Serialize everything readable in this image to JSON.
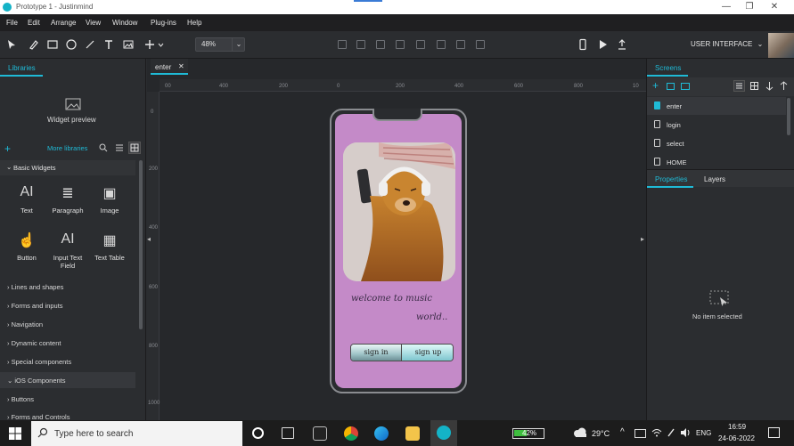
{
  "window": {
    "title": "Prototype 1 - Justinmind",
    "min": "—",
    "max": "❐",
    "close": "✕"
  },
  "menu": [
    "File",
    "Edit",
    "Arrange",
    "View",
    "Window",
    "Plug-ins",
    "Help"
  ],
  "toolbar": {
    "zoom": "48%",
    "zoom_caret": "⌄",
    "mode_label": "USER INTERFACE",
    "mode_caret": "⌄"
  },
  "left_panel": {
    "tab": "Libraries",
    "preview_label": "Widget preview",
    "more_libraries": "More libraries",
    "basic_widgets": "Basic Widgets",
    "widgets": [
      "Text",
      "Paragraph",
      "Image",
      "Button",
      "Input Text Field",
      "Text Table"
    ],
    "widget_glyphs": [
      "AI",
      "≣",
      "▣",
      "☝",
      "AI",
      "▦"
    ],
    "categories": [
      "Lines and shapes",
      "Forms and inputs",
      "Navigation",
      "Dynamic content",
      "Special components",
      "iOS Components",
      "Buttons",
      "Forms and Controls"
    ],
    "caret_open": "⌄",
    "caret_closed": "›"
  },
  "canvas": {
    "tab_label": "enter",
    "tab_close": "✕",
    "ruler_h": [
      "00",
      "400",
      "200",
      "0",
      "200",
      "400",
      "600",
      "800",
      "10"
    ],
    "ruler_v": [
      "0",
      "200",
      "400",
      "600",
      "800",
      "1000"
    ],
    "phone": {
      "welcome_line1": "welcome to music",
      "welcome_line2": "world..",
      "signin": "sign in",
      "signup": "sign up"
    }
  },
  "right_panel": {
    "tab": "Screens",
    "screens": [
      "enter",
      "login",
      "select",
      "HOME"
    ],
    "properties_tab": "Properties",
    "layers_tab": "Layers",
    "no_selection": "No item selected"
  },
  "taskbar": {
    "search_placeholder": "Type here to search",
    "battery": "42%",
    "weather": "29°C",
    "lang": "ENG",
    "time": "16:59",
    "date": "24-06-2022"
  },
  "colors": {
    "accent": "#1fbad6",
    "phone_bg": "#c48ac8"
  }
}
